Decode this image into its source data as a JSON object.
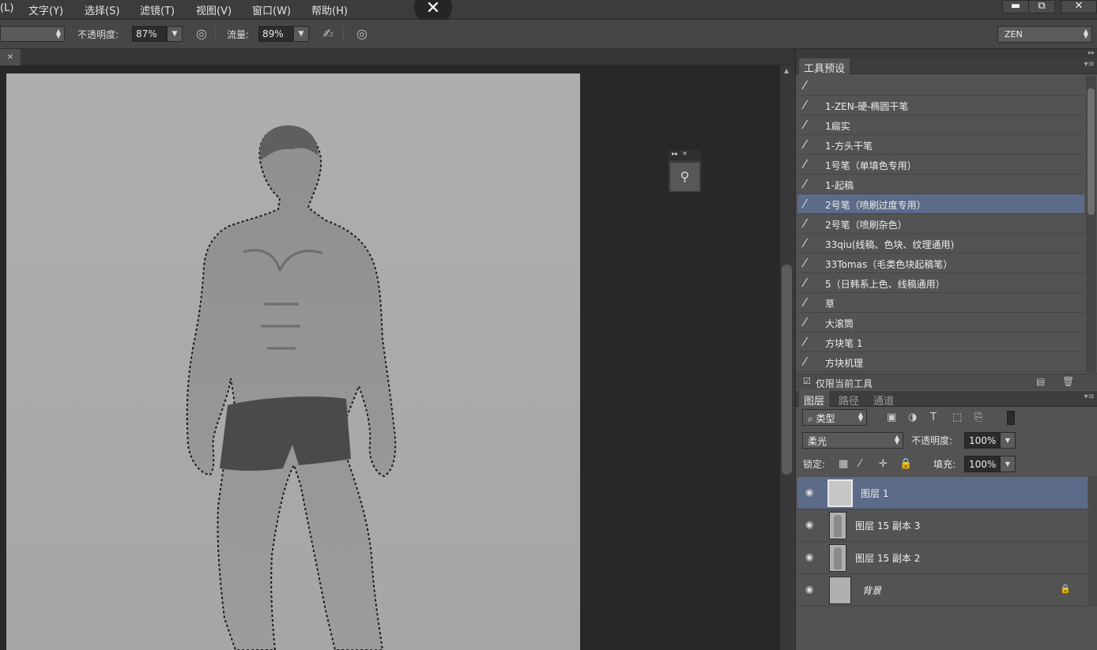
{
  "menu": [
    {
      "label": "(L)"
    },
    {
      "label": "文字(Y)"
    },
    {
      "label": "选择(S)"
    },
    {
      "label": "滤镜(T)"
    },
    {
      "label": "视图(V)"
    },
    {
      "label": "窗口(W)"
    },
    {
      "label": "帮助(H)"
    }
  ],
  "window_controls": {
    "minimize": "▬",
    "restore": "⧉",
    "close": "✕"
  },
  "overlay_close": "✕",
  "options_bar": {
    "opacity_label": "不透明度:",
    "opacity_value": "87%",
    "flow_label": "流量:",
    "flow_value": "89%",
    "workspace": "ZEN"
  },
  "document_tab": {
    "close": "×"
  },
  "tool_presets": {
    "tab_label": "工具预设",
    "items": [
      {
        "label": ""
      },
      {
        "label": "1-ZEN-硬-椭圆干笔"
      },
      {
        "label": "1扁实"
      },
      {
        "label": "1-方头干笔"
      },
      {
        "label": "1号笔（单填色专用）"
      },
      {
        "label": "1-起稿"
      },
      {
        "label": "2号笔（喷刷过度专用）",
        "selected": true
      },
      {
        "label": "2号笔（喷刷杂色）"
      },
      {
        "label": "33qiu(线稿、色块、纹理通用)"
      },
      {
        "label": "33Tomas（毛类色块起稿笔）"
      },
      {
        "label": "5（日韩系上色、线稿通用）"
      },
      {
        "label": "草"
      },
      {
        "label": "大滚筒"
      },
      {
        "label": "方块笔 1"
      },
      {
        "label": "方块机理"
      }
    ],
    "current_tool_only_label": "仅限当前工具",
    "current_tool_only_checked": true
  },
  "layers_panel": {
    "tabs": [
      {
        "label": "图层",
        "active": true
      },
      {
        "label": "路径",
        "active": false
      },
      {
        "label": "通道",
        "active": false
      }
    ],
    "filter_kind": "类型",
    "blend_mode": "柔光",
    "opacity_label": "不透明度:",
    "opacity_value": "100%",
    "lock_label": "锁定:",
    "fill_label": "填充:",
    "fill_value": "100%",
    "layers": [
      {
        "name": "图层 1",
        "selected": true
      },
      {
        "name": "图层 15 副本 3",
        "selected": false
      },
      {
        "name": "图层 15 副本 2",
        "selected": false
      },
      {
        "name": "背景",
        "selected": false,
        "locked": true
      }
    ]
  }
}
